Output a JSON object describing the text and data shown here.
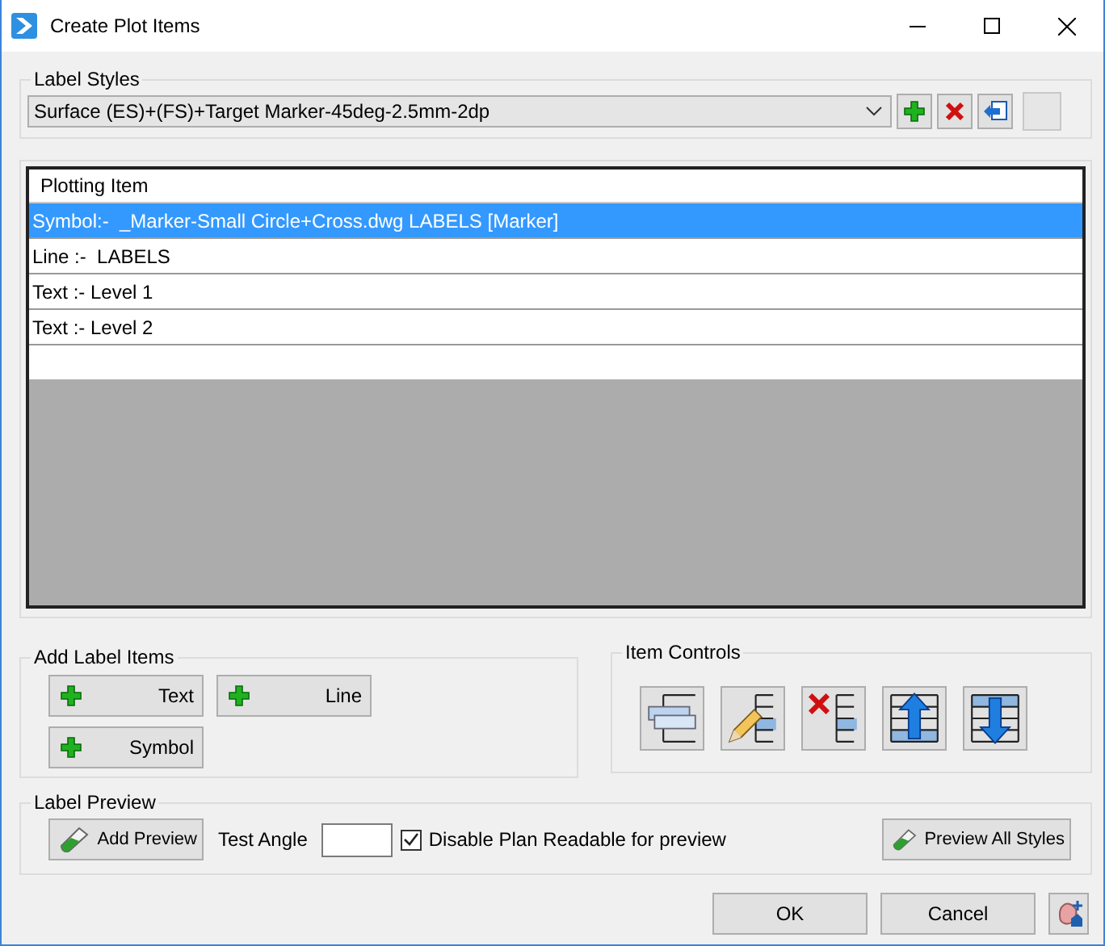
{
  "window": {
    "title": "Create Plot Items"
  },
  "label_styles": {
    "title": "Label Styles",
    "selected_style": "Surface (ES)+(FS)+Target Marker-45deg-2.5mm-2dp"
  },
  "plotting_table": {
    "column": "Plotting Item",
    "rows": [
      {
        "text": "Symbol:-  _Marker-Small Circle+Cross.dwg LABELS [Marker]",
        "selected": true
      },
      {
        "text": "Line :-  LABELS",
        "selected": false
      },
      {
        "text": "Text :- Level 1",
        "selected": false
      },
      {
        "text": "Text :- Level 2",
        "selected": false
      }
    ]
  },
  "add_label_items": {
    "title": "Add Label Items",
    "buttons": [
      "Text",
      "Line",
      "Symbol"
    ]
  },
  "item_controls": {
    "title": "Item Controls",
    "buttons": [
      {
        "kind": "copy"
      },
      {
        "kind": "edit"
      },
      {
        "kind": "delete"
      },
      {
        "kind": "up"
      },
      {
        "kind": "down"
      }
    ]
  },
  "label_preview": {
    "title": "Label Preview",
    "add_preview": "Add Preview",
    "test_angle_label": "Test Angle",
    "disable_plan_readable": {
      "label": "Disable Plan Readable for preview",
      "checked": true
    },
    "preview_all": "Preview All Styles"
  },
  "buttons": [
    "OK",
    "Cancel"
  ]
}
